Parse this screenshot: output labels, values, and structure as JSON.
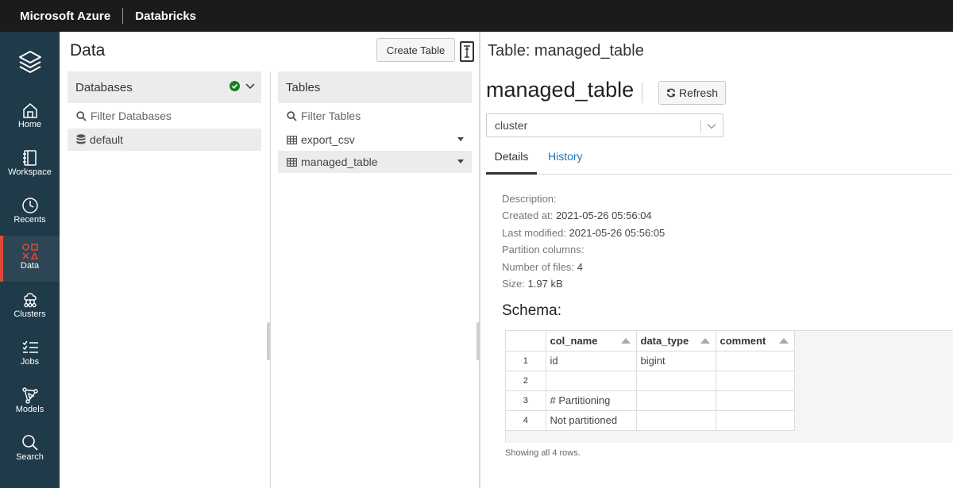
{
  "topbar": {
    "brand": "Microsoft Azure",
    "product": "Databricks"
  },
  "nav": {
    "items": [
      {
        "label": "Home",
        "icon": "home-icon"
      },
      {
        "label": "Workspace",
        "icon": "workspace-icon"
      },
      {
        "label": "Recents",
        "icon": "clock-icon"
      },
      {
        "label": "Data",
        "icon": "data-icon",
        "active": true
      },
      {
        "label": "Clusters",
        "icon": "clusters-icon"
      },
      {
        "label": "Jobs",
        "icon": "jobs-icon"
      },
      {
        "label": "Models",
        "icon": "models-icon"
      },
      {
        "label": "Search",
        "icon": "search-icon"
      }
    ],
    "active_color": "#e04a3a"
  },
  "data_panel": {
    "title": "Data",
    "create_table_label": "Create Table",
    "databases": {
      "header": "Databases",
      "filter_placeholder": "Filter Databases",
      "items": [
        "default"
      ]
    },
    "tables": {
      "header": "Tables",
      "filter_placeholder": "Filter Tables",
      "items": [
        "export_csv",
        "managed_table"
      ]
    }
  },
  "table_view": {
    "header": "Table: managed_table",
    "name": "managed_table",
    "refresh_label": "Refresh",
    "cluster": "cluster",
    "tabs": [
      "Details",
      "History"
    ],
    "details": {
      "description_label": "Description:",
      "created_label": "Created at:",
      "created_value": "2021-05-26 05:56:04",
      "modified_label": "Last modified:",
      "modified_value": "2021-05-26 05:56:05",
      "partition_label": "Partition columns:",
      "files_label": "Number of files:",
      "files_value": "4",
      "size_label": "Size:",
      "size_value": "1.97 kB"
    },
    "schema": {
      "title": "Schema:",
      "columns": [
        "col_name",
        "data_type",
        "comment"
      ],
      "rows": [
        {
          "n": "1",
          "col_name": "id",
          "data_type": "bigint",
          "comment": ""
        },
        {
          "n": "2",
          "col_name": "",
          "data_type": "",
          "comment": ""
        },
        {
          "n": "3",
          "col_name": "# Partitioning",
          "data_type": "",
          "comment": ""
        },
        {
          "n": "4",
          "col_name": "Not partitioned",
          "data_type": "",
          "comment": ""
        }
      ],
      "footer": "Showing all 4 rows."
    }
  },
  "colors": {
    "topbar": "#1b1b1b",
    "sidebar": "#1f3a48",
    "link": "#1a75bb",
    "success": "#1a7f1a"
  }
}
